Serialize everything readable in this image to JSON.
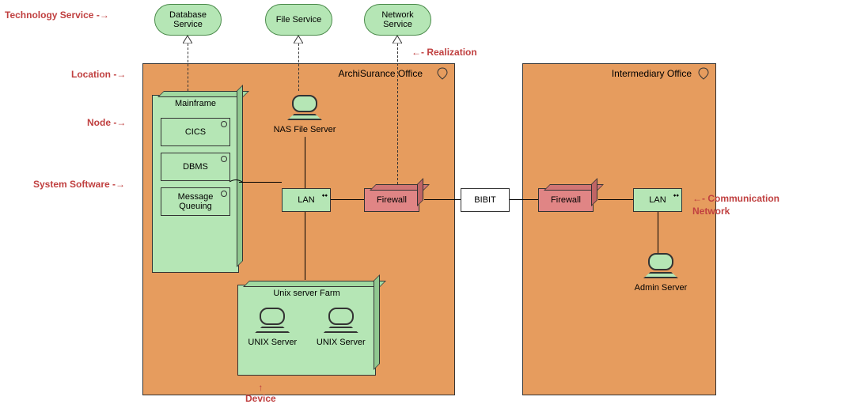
{
  "annotations": {
    "technologyService": "Technology Service",
    "location": "Location",
    "node": "Node",
    "systemSoftware": "System Software",
    "device": "Device",
    "realization": "Realization",
    "communicationNetwork": "Communication Network"
  },
  "services": {
    "database": "Database Service",
    "file": "File Service",
    "network": "Network Service"
  },
  "locations": {
    "archisurance": "ArchiSurance Office",
    "intermediary": "Intermediary Office"
  },
  "mainframe": {
    "title": "Mainframe",
    "cics": "CICS",
    "dbms": "DBMS",
    "mq": "Message Queuing"
  },
  "devices": {
    "nasFileServer": "NAS File Server",
    "adminServer": "Admin Server",
    "unixServer": "UNIX Server"
  },
  "nodes": {
    "unixFarm": "Unix server Farm"
  },
  "network": {
    "lan": "LAN",
    "firewall": "Firewall",
    "bibit": "BIBIT"
  }
}
